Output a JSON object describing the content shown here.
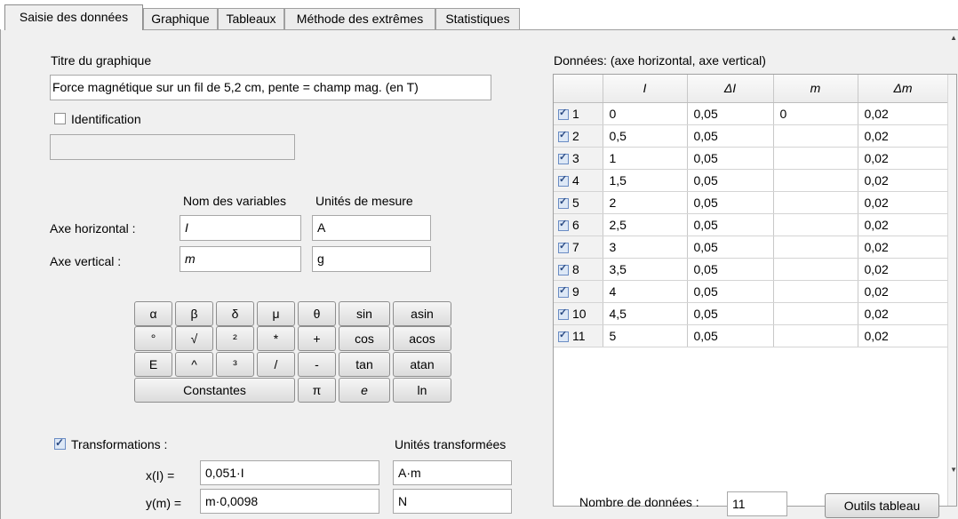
{
  "tabs": [
    {
      "label": "Saisie des données"
    },
    {
      "label": "Graphique"
    },
    {
      "label": "Tableaux"
    },
    {
      "label": "Méthode des extrêmes"
    },
    {
      "label": "Statistiques"
    }
  ],
  "form": {
    "title_label": "Titre du graphique",
    "title_value": "Force magnétique sur un fil de 5,2 cm, pente = champ mag. (en T)",
    "identification_label": "Identification",
    "identification_value": "",
    "var_names_header": "Nom des variables",
    "units_header": "Unités de mesure",
    "horizontal_axis_label": "Axe horizontal :",
    "horizontal_var": "I",
    "horizontal_unit": "A",
    "vertical_axis_label": "Axe vertical :",
    "vertical_var": "m",
    "vertical_unit": "g"
  },
  "keypad": {
    "row1": [
      "α",
      "β",
      "δ",
      "μ",
      "θ",
      "sin",
      "asin"
    ],
    "row2": [
      "°",
      "√",
      "²",
      "*",
      "+",
      "cos",
      "acos"
    ],
    "row3": [
      "E",
      "^",
      "³",
      "/",
      "-",
      "tan",
      "atan"
    ],
    "constants": "Constantes",
    "pi": "π",
    "e": "e",
    "ln": "ln"
  },
  "transformations": {
    "label": "Transformations :",
    "units_header": "Unités transformées",
    "x_label": "x(I) =",
    "x_value": "0,051·I",
    "x_unit": "A·m",
    "y_label": "y(m) =",
    "y_value": "m·0,0098",
    "y_unit": "N"
  },
  "table": {
    "title": "Données: (axe horizontal, axe vertical)",
    "headers": [
      "",
      "I",
      "ΔI",
      "m",
      "Δm"
    ],
    "rows": [
      [
        "1",
        "0",
        "0,05",
        "0",
        "0,02"
      ],
      [
        "2",
        "0,5",
        "0,05",
        "",
        "0,02"
      ],
      [
        "3",
        "1",
        "0,05",
        "",
        "0,02"
      ],
      [
        "4",
        "1,5",
        "0,05",
        "",
        "0,02"
      ],
      [
        "5",
        "2",
        "0,05",
        "",
        "0,02"
      ],
      [
        "6",
        "2,5",
        "0,05",
        "",
        "0,02"
      ],
      [
        "7",
        "3",
        "0,05",
        "",
        "0,02"
      ],
      [
        "8",
        "3,5",
        "0,05",
        "",
        "0,02"
      ],
      [
        "9",
        "4",
        "0,05",
        "",
        "0,02"
      ],
      [
        "10",
        "4,5",
        "0,05",
        "",
        "0,02"
      ],
      [
        "11",
        "5",
        "0,05",
        "",
        "0,02"
      ]
    ],
    "count_label": "Nombre de données :",
    "count_value": "11",
    "tools_button": "Outils tableau"
  }
}
